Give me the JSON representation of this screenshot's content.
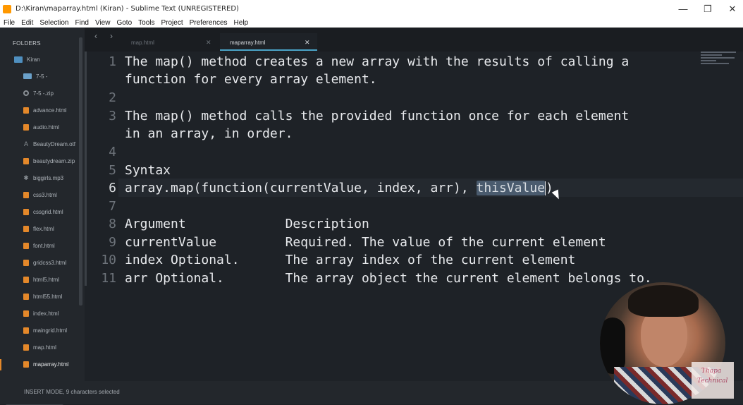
{
  "window": {
    "title": "D:\\Kiran\\maparray.html (Kiran) - Sublime Text (UNREGISTERED)",
    "minimize": "—",
    "maximize": "❐",
    "close": "✕"
  },
  "menu": [
    "File",
    "Edit",
    "Selection",
    "Find",
    "View",
    "Goto",
    "Tools",
    "Project",
    "Preferences",
    "Help"
  ],
  "sidebar": {
    "header": "FOLDERS",
    "root": "Kiran",
    "items": [
      {
        "label": "7-5 -",
        "icon": "folder-icon"
      },
      {
        "label": "7-5 -.zip",
        "icon": "gear-icon"
      },
      {
        "label": "advance.html",
        "icon": "file-icon"
      },
      {
        "label": "audio.html",
        "icon": "file-icon"
      },
      {
        "label": "BeautyDream.otf",
        "icon": "font-icon"
      },
      {
        "label": "beautydream.zip",
        "icon": "file-icon"
      },
      {
        "label": "biggirls.mp3",
        "icon": "music-icon"
      },
      {
        "label": "css3.html",
        "icon": "file-icon"
      },
      {
        "label": "cssgrid.html",
        "icon": "file-icon"
      },
      {
        "label": "flex.html",
        "icon": "file-icon"
      },
      {
        "label": "font.html",
        "icon": "file-icon"
      },
      {
        "label": "gridcss3.html",
        "icon": "file-icon"
      },
      {
        "label": "html5.html",
        "icon": "file-icon"
      },
      {
        "label": "html55.html",
        "icon": "file-icon"
      },
      {
        "label": "index.html",
        "icon": "file-icon"
      },
      {
        "label": "maingrid.html",
        "icon": "file-icon"
      },
      {
        "label": "map.html",
        "icon": "file-icon"
      },
      {
        "label": "maparray.html",
        "icon": "file-icon"
      }
    ]
  },
  "tabs": [
    {
      "label": "map.html",
      "close": "✕"
    },
    {
      "label": "maparray.html",
      "close": "✕"
    }
  ],
  "nav": {
    "back": "‹",
    "forward": "›"
  },
  "editor": {
    "line_numbers": [
      "1",
      "2",
      "3",
      "4",
      "5",
      "6",
      "7",
      "8",
      "9",
      "10",
      "11"
    ],
    "lines": [
      "The map() method creates a new array with the results of calling a",
      "function for every array element.",
      "",
      "The map() method calls the provided function once for each element",
      "in an array, in order.",
      "",
      "Syntax",
      "array.map(function(currentValue, index, arr), ",
      "thisValue",
      ")",
      "",
      "Argument             Description",
      "currentValue         Required. The value of the current element",
      "index Optional.      The array index of the current element",
      "arr Optional.        The array object the current element belongs to."
    ]
  },
  "status": {
    "text": "INSERT MODE, 9 characters selected"
  },
  "watermark": {
    "line1": "Thapa",
    "line2": "Technical"
  }
}
